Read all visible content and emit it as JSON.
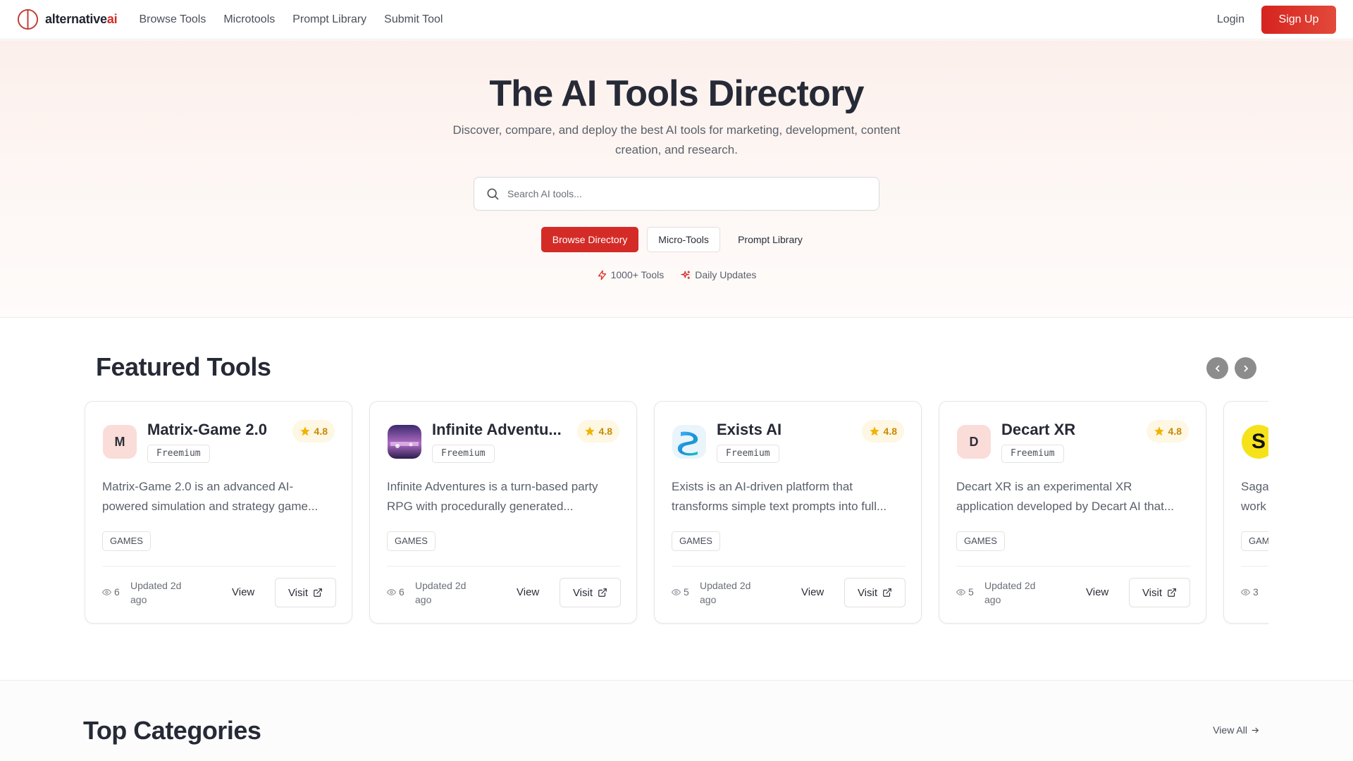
{
  "nav": {
    "logo_main": "alternative",
    "logo_accent": "ai",
    "links": [
      {
        "label": "Browse Tools"
      },
      {
        "label": "Microtools"
      },
      {
        "label": "Prompt Library"
      },
      {
        "label": "Submit Tool"
      }
    ],
    "login": "Login",
    "signup": "Sign Up"
  },
  "hero": {
    "title": "The AI Tools Directory",
    "subtitle": "Discover, compare, and deploy the best AI tools for marketing, development, content creation, and research.",
    "search_placeholder": "Search AI tools...",
    "buttons": {
      "primary": "Browse Directory",
      "secondary": "Micro-Tools",
      "tertiary": "Prompt Library"
    },
    "stats": [
      {
        "label": "1000+ Tools",
        "icon": "zap-icon"
      },
      {
        "label": "Daily Updates",
        "icon": "sparkle-icon"
      }
    ]
  },
  "featured": {
    "title": "Featured Tools",
    "cards": [
      {
        "name": "Matrix-Game 2.0",
        "initial": "M",
        "pricing": "Freemium",
        "rating": "4.8",
        "description": "Matrix-Game 2.0 is an advanced AI-powered simulation and strategy game...",
        "tag": "GAMES",
        "views": "6",
        "updated": "Updated 2d ago",
        "view": "View",
        "visit": "Visit"
      },
      {
        "name": "Infinite Adventu...",
        "initial": "",
        "pricing": "Freemium",
        "rating": "4.8",
        "description": "Infinite Adventures is a turn-based party RPG with procedurally generated...",
        "tag": "GAMES",
        "views": "6",
        "updated": "Updated 2d ago",
        "view": "View",
        "visit": "Visit"
      },
      {
        "name": "Exists AI",
        "initial": "",
        "pricing": "Freemium",
        "rating": "4.8",
        "description": "Exists is an AI-driven platform that transforms simple text prompts into full...",
        "tag": "GAMES",
        "views": "5",
        "updated": "Updated 2d ago",
        "view": "View",
        "visit": "Visit"
      },
      {
        "name": "Decart XR",
        "initial": "D",
        "pricing": "Freemium",
        "rating": "4.8",
        "description": "Decart XR is an experimental XR application developed by Decart AI that...",
        "tag": "GAMES",
        "views": "5",
        "updated": "Updated 2d ago",
        "view": "View",
        "visit": "Visit"
      },
      {
        "name": "",
        "initial": "S",
        "pricing": "",
        "rating": "",
        "description": "Saga work",
        "tag": "GAM",
        "views": "3",
        "updated": "",
        "view": "",
        "visit": ""
      }
    ]
  },
  "categories": {
    "title": "Top Categories",
    "view_all": "View All"
  },
  "colors": {
    "brand": "#d42b27",
    "rating": "#c98a00",
    "rating_bg": "#fef7e3"
  }
}
